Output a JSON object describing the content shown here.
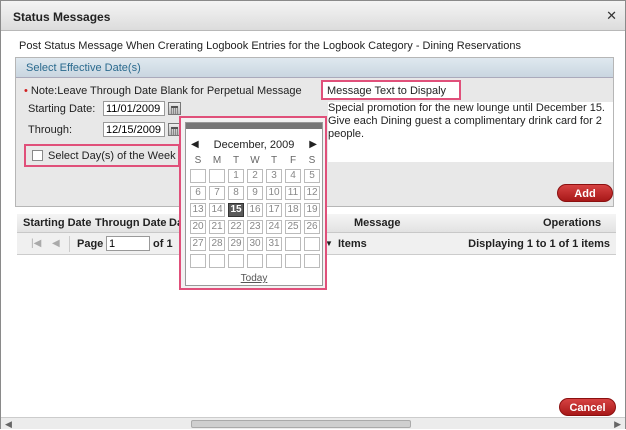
{
  "window": {
    "title": "Status Messages",
    "close_icon": "close-icon"
  },
  "heading": "Post Status Message When Crerating Logbook Entries for the Logbook Category - Dining Reservations",
  "section": {
    "header": "Select Effective Date(s)",
    "note_bullet": "•",
    "note": "Note:Leave Through Date Blank for Perpetual Message",
    "starting_label": "Starting Date:",
    "starting_value": "11/01/2009",
    "through_label": "Through:",
    "through_value": "12/15/2009",
    "week_label": "Select Day(s) of the Week",
    "msg_label": "Message Text to Dispaly",
    "msg_text": "Special promotion for the new lounge until December 15. Give each Dining guest a complimentary drink card for 2 people.",
    "add_label": "Add"
  },
  "grid": {
    "columns": [
      "Starting Date",
      "Througn Date",
      "Da",
      "Message",
      "Operations"
    ],
    "pager": {
      "page_label": "Page",
      "page_value": "1",
      "of_label": "of 1",
      "items_label": "Items",
      "display": "Displaying 1 to 1 of 1 items"
    }
  },
  "calendar": {
    "month": "December,  2009",
    "prev": "◀",
    "next": "▶",
    "dow": [
      "S",
      "M",
      "T",
      "W",
      "T",
      "F",
      "S"
    ],
    "selected": 15,
    "today_label": "Today"
  },
  "cancel_label": "Cancel",
  "colors": {
    "accent": "#b82020",
    "highlight": "#e0507a",
    "header_text": "#2a6a8e"
  }
}
